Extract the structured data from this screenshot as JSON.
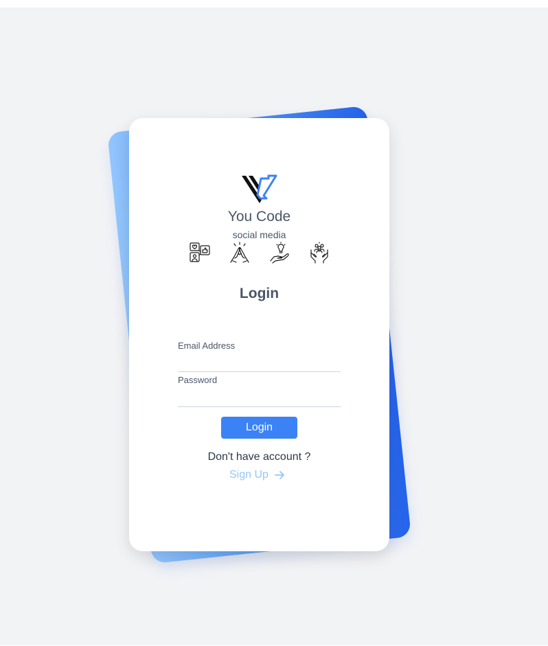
{
  "brand": {
    "name": "You Code",
    "tagline": "social media"
  },
  "colors": {
    "accent": "#3b82f6",
    "gradient_start": "#93c5fd",
    "gradient_end": "#2563eb",
    "text": "#4a5568",
    "link": "#93c5fd"
  },
  "feature_icons": [
    "social-media-icon",
    "high-five-icon",
    "idea-hand-icon",
    "community-hands-icon"
  ],
  "login": {
    "heading": "Login",
    "email_label": "Email Address",
    "email_value": "",
    "password_label": "Password",
    "password_value": "",
    "submit_label": "Login"
  },
  "signup": {
    "prompt": "Don't have account ?",
    "link_label": "Sign Up",
    "link_icon": "arrow-right-icon"
  }
}
